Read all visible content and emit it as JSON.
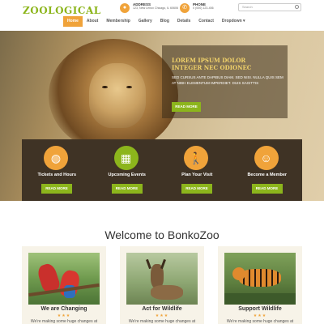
{
  "header": {
    "logo": "ZOOLOGICAL",
    "address_label": "ADDRESS",
    "address_value": "123, New Lenox Chicago, IL 60606",
    "phone_label": "PHONE",
    "phone_value": "0 (000) 123-456",
    "search_placeholder": "Search"
  },
  "nav": {
    "items": [
      "Home",
      "About",
      "Membership",
      "Gallery",
      "Blog",
      "Details",
      "Contact",
      "Dropdown ▾"
    ]
  },
  "hero": {
    "title_line1": "LOREM IPSUM DOLOR",
    "title_line2": "INTEGER NEC ODIONEC",
    "text": "SED CURSUS ANTE DAPIBUS DIAM. SED NISI. NULLA QUIS SEM AT NIBH ELEMENTUM IMPERDIET. DUIS SAGITTIS",
    "button": "READ MORE"
  },
  "features": [
    {
      "title": "Tickets and Hours",
      "button": "READ MORE",
      "icon": "basketball-icon"
    },
    {
      "title": "Upcoming Events",
      "button": "READ MORE",
      "icon": "calendar-icon"
    },
    {
      "title": "Plan Your Visit",
      "button": "READ MORE",
      "icon": "walking-icon"
    },
    {
      "title": "Become a Member",
      "button": "READ MORE",
      "icon": "group-icon"
    }
  ],
  "welcome": "Welcome to BonkoZoo",
  "cards": [
    {
      "title": "We are Changing",
      "stars": "★★★",
      "desc": "We're making some huge changes at"
    },
    {
      "title": "Act for Wildlife",
      "stars": "★★★",
      "desc": "We're making some huge changes at"
    },
    {
      "title": "Support Wildlife",
      "stars": "★★★",
      "desc": "We're making some huge changes at"
    }
  ],
  "colors": {
    "accent_orange": "#f0a33a",
    "accent_green": "#8cb51c",
    "dark_band": "#3f3325"
  }
}
